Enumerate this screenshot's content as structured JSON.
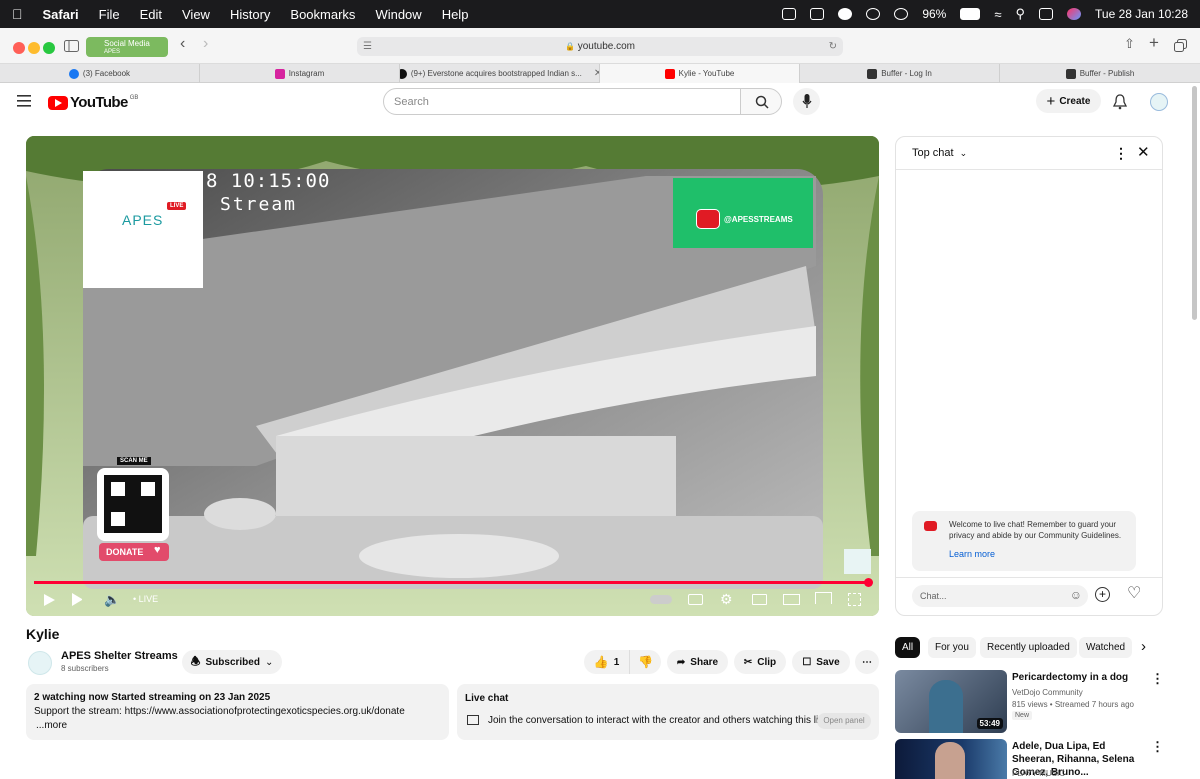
{
  "menubar": {
    "app": "Safari",
    "items": [
      "File",
      "Edit",
      "View",
      "History",
      "Bookmarks",
      "Window",
      "Help"
    ],
    "battery": "96%",
    "datetime": "Tue 28 Jan  10:28"
  },
  "safari": {
    "tab_group": {
      "name": "Social Media",
      "sub": "APES"
    },
    "url": "youtube.com",
    "tabs": [
      {
        "label": "(3) Facebook",
        "icon": "facebook-icon",
        "color": "#1877f2"
      },
      {
        "label": "Instagram",
        "icon": "instagram-icon",
        "color": "#d6249f"
      },
      {
        "label": "(9+) Everstone acquires bootstrapped Indian s...",
        "icon": "threads-icon",
        "color": "#111111"
      },
      {
        "label": "Kylie - YouTube",
        "icon": "youtube-icon",
        "color": "#ff0000"
      },
      {
        "label": "Buffer - Log In",
        "icon": "buffer-icon",
        "color": "#333333"
      },
      {
        "label": "Buffer - Publish",
        "icon": "buffer-icon",
        "color": "#333333"
      }
    ]
  },
  "youtube": {
    "logo": "YouTube",
    "region": "GB",
    "search_placeholder": "Search",
    "create_label": "Create"
  },
  "video": {
    "overlay_time": "8 10:15:00",
    "overlay_stream": "Stream",
    "apes_logo": "APES",
    "live_badge": "LIVE",
    "channel_banner": "@APESSTREAMS",
    "scan_me": "SCAN ME",
    "donate": "DONATE",
    "live_label": "LIVE"
  },
  "chat": {
    "header": "Top chat",
    "welcome": "Welcome to live chat! Remember to guard your privacy and abide by our Community Guidelines.",
    "learn_more": "Learn more",
    "placeholder": "Chat..."
  },
  "details": {
    "title": "Kylie",
    "channel": "APES Shelter Streams",
    "subscribers": "8 subscribers",
    "subscribed_label": "Subscribed",
    "likes": "1",
    "share": "Share",
    "clip": "Clip",
    "save": "Save",
    "desc_line1": "2 watching now  Started streaming on 23 Jan 2025",
    "desc_line2": "Support the stream: https://www.associationofprotectingexoticspecies.org.uk/donate",
    "desc_more": "...more",
    "livechat_title": "Live chat",
    "livechat_text": "Join the conversation to interact with the creator and others watching this li...",
    "open_panel": "Open panel"
  },
  "chips": [
    "All",
    "For you",
    "Recently uploaded",
    "Watched"
  ],
  "recommendations": [
    {
      "title": "Pericardectomy in a dog",
      "channel": "VetDojo Community",
      "meta": "815 views  •  Streamed 7 hours ago",
      "badge": "New",
      "duration": "53:49"
    },
    {
      "title": "Adele, Dua Lipa, Ed Sheeran, Rihanna, Selena Gomez, Bruno...",
      "channel": "PLAYY MUSIC",
      "meta": "",
      "badge": "",
      "duration": ""
    }
  ]
}
